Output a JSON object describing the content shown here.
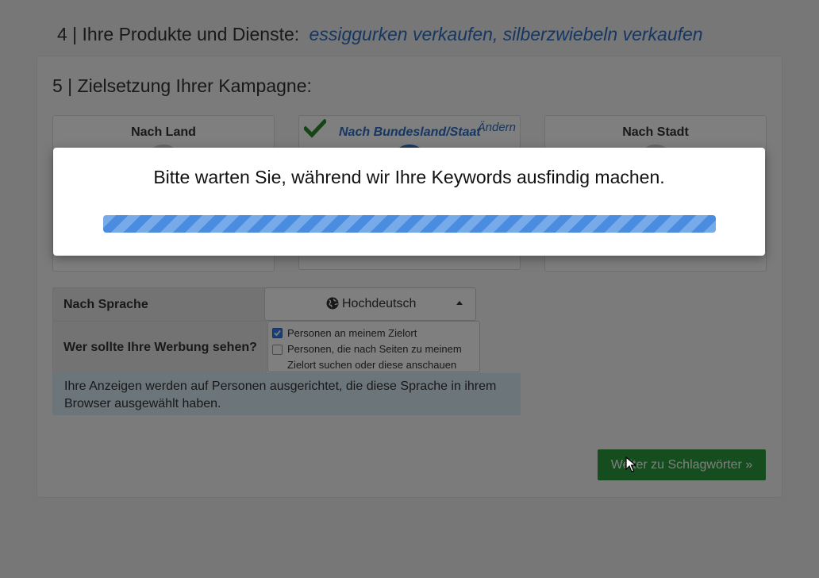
{
  "section4": {
    "heading": "4 | Ihre Produkte und Dienste:",
    "products": "essiggurken verkaufen, silberzwiebeln verkaufen"
  },
  "section5": {
    "heading": "5 | Zielsetzung Ihrer Kampagne:"
  },
  "targeting_cards": [
    {
      "title": "Nach Land"
    },
    {
      "title": "Nach Bundesland/Staat",
      "selected": true,
      "edit_label": "Ändern"
    },
    {
      "title": "Nach Stadt"
    }
  ],
  "language": {
    "label": "Nach Sprache",
    "selected": "Hochdeutsch"
  },
  "audience": {
    "label": "Wer sollte Ihre Werbung sehen?",
    "option1": {
      "text": "Personen an meinem Zielort",
      "checked": true
    },
    "option2": {
      "line1": "Personen, die nach Seiten zu meinem",
      "line2": "Zielort suchen oder diese anschauen",
      "checked": false
    }
  },
  "info": {
    "text": "Ihre Anzeigen werden auf Personen ausgerichtet, die diese Sprache in ihrem Browser ausgewählt haben."
  },
  "next_button": {
    "label": "Weiter zu Schlagwörter »"
  },
  "modal": {
    "message": "Bitte warten Sie, während wir Ihre Keywords ausfindig machen.",
    "progress": 1.0
  },
  "colors": {
    "accent_blue": "#2d6fc4",
    "progress_blue": "#4a8de0",
    "button_green": "#2a9a3c",
    "check_green": "#2a8a2a"
  }
}
